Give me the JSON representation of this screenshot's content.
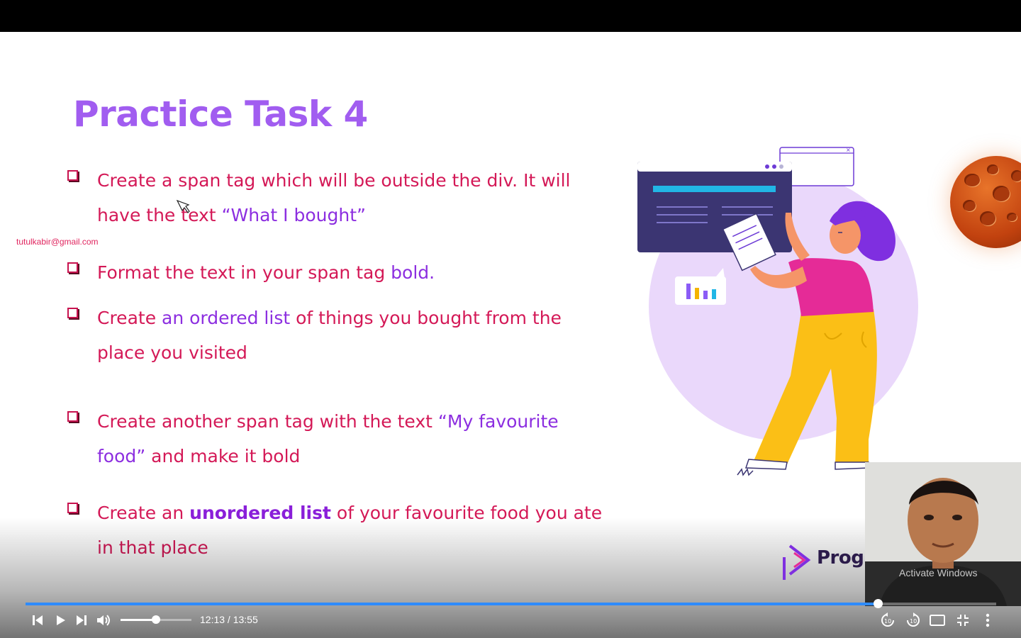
{
  "slide": {
    "title": "Practice Task 4",
    "watermark": "tutulkabir@gmail.com",
    "tasks": [
      {
        "parts": [
          {
            "t": "Create a span tag which will be outside the div. It will have the text  ",
            "c": "r"
          },
          {
            "t": "“What I bought”",
            "c": "p"
          }
        ]
      },
      {
        "parts": [
          {
            "t": "Format the text in your span tag ",
            "c": "r"
          },
          {
            "t": "bold.",
            "c": "p"
          }
        ]
      },
      {
        "parts": [
          {
            "t": "Create ",
            "c": "r"
          },
          {
            "t": "an ordered list",
            "c": "p"
          },
          {
            "t": " of things you bought from the place you visited",
            "c": "r"
          }
        ]
      },
      {
        "parts": [
          {
            "t": "Create another span tag with the text ",
            "c": "r"
          },
          {
            "t": "“My favourite food”",
            "c": "p"
          },
          {
            "t": " and make it bold",
            "c": "r"
          }
        ]
      },
      {
        "parts": [
          {
            "t": "Create an ",
            "c": "r"
          },
          {
            "t": "unordered list",
            "c": "pb"
          },
          {
            "t": " of ",
            "c": "r"
          },
          {
            "t": "your favourite food you ate in that place",
            "c": "r"
          }
        ]
      }
    ],
    "logo_text": "Programmi",
    "activate_text": "Activate Windows"
  },
  "player": {
    "current_time": "12:13",
    "duration": "13:55",
    "time_label": "12:13 / 13:55",
    "progress_fraction": 0.878,
    "volume_fraction": 0.5,
    "icons": [
      "previous-icon",
      "play-icon",
      "next-icon",
      "volume-icon",
      "rewind-10-icon",
      "forward-10-icon",
      "theater-mode-icon",
      "exit-fullscreen-icon",
      "more-icon"
    ]
  },
  "colors": {
    "title": "#a15df0",
    "task_text": "#d41957",
    "highlight": "#8c2ee0",
    "progress": "#2e8bff"
  }
}
